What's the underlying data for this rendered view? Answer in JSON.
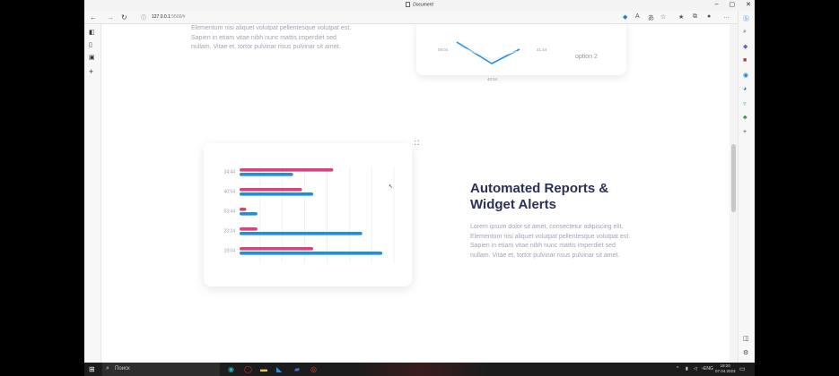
{
  "window": {
    "title": "Document",
    "min": "–",
    "max": "▢",
    "close": "✕"
  },
  "toolbar": {
    "url_host": "127.0.0.1",
    "url_port": ":5500/#",
    "back": "←",
    "forward": "→",
    "reload": "↻",
    "info": "ⓘ",
    "more": "…"
  },
  "top_section": {
    "paragraph_lines": [
      "Elementum nisi aliquet volutpat pellentesque volutpat est.",
      "Sapien in etiam vitae nibh nunc mattis imperdiet sed",
      "nullam. Vitae et, tortor pulvinar risus pulvinar sit amet."
    ],
    "top_card": {
      "labels": [
        "09:04",
        "21:44",
        "40:54"
      ],
      "option_label": "option 2"
    }
  },
  "feature": {
    "title_line1": "Automated Reports &",
    "title_line2": "Widget Alerts",
    "paragraph_lines": [
      "Lorem ipsum dolor sit amet, consectetur adipiscing elit.",
      "Elementum nisi aliquet volutpat pellentesque volutpat est.",
      "Sapien in etiam vitae nibh nunc mattis imperdiet sed",
      "nullam. Vitae et, tortor pulvinar risus pulvinar sit amet."
    ]
  },
  "chart_data": {
    "type": "bar",
    "orientation": "horizontal",
    "categories": [
      "34:44",
      "40:54",
      "53:44",
      "23:24",
      "19:04"
    ],
    "series": [
      {
        "color": "#d6447f",
        "values": [
          42,
          28,
          3,
          8,
          33
        ]
      },
      {
        "color": "#1e8ee0",
        "values": [
          24,
          33,
          8,
          55,
          64
        ]
      }
    ],
    "xlim": [
      0,
      70
    ],
    "grid": true
  },
  "taskbar": {
    "search_placeholder": "Поиск",
    "lang": "ENG",
    "time": "18:20",
    "date": "07.04.2023"
  },
  "colors": {
    "title": "#2a3157",
    "paragraph": "#a4a4b4",
    "bar_pink": "#d6447f",
    "bar_blue": "#1e8ee0"
  }
}
